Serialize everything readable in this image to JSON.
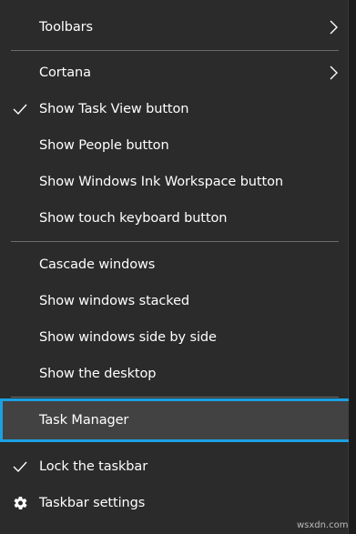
{
  "menu": {
    "toolbars": "Toolbars",
    "cortana": "Cortana",
    "show_task_view": "Show Task View button",
    "show_people": "Show People button",
    "show_ink_workspace": "Show Windows Ink Workspace button",
    "show_touch_keyboard": "Show touch keyboard button",
    "cascade_windows": "Cascade windows",
    "show_stacked": "Show windows stacked",
    "show_side_by_side": "Show windows side by side",
    "show_desktop": "Show the desktop",
    "task_manager": "Task Manager",
    "lock_taskbar": "Lock the taskbar",
    "taskbar_settings": "Taskbar settings"
  },
  "checked": {
    "show_task_view": true,
    "lock_taskbar": true
  },
  "icons": {
    "submenu": "chevron-right-icon",
    "check": "checkmark-icon",
    "settings": "gear-icon"
  },
  "colors": {
    "menu_background": "#2b2b2b",
    "highlight_background": "#424242",
    "highlight_border": "#1ba1e2",
    "separator": "#6b6b6b",
    "text": "#ffffff"
  },
  "watermark": "wsxdn.com"
}
